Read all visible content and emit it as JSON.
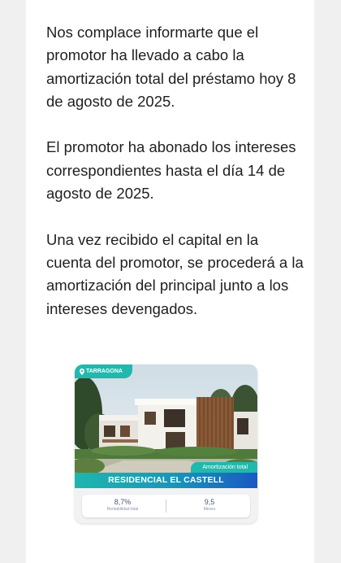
{
  "email": {
    "paragraphs": [
      "Nos complace informarte que el promotor ha llevado a cabo la amortización total del préstamo hoy 8 de agosto de 2025.",
      "El promotor ha abonado los intereses correspondientes hasta el día 14 de agosto de 2025.",
      "Una vez recibido el capital en la cuenta del promotor, se procederá a la amortización del principal junto a los intereses devengados."
    ]
  },
  "project_card": {
    "location": "TARRAGONA",
    "status_tag": "Amortización total",
    "title": "RESIDENCIAL EL CASTELL",
    "stats": [
      {
        "value": "8,7%",
        "label": "Rentabilidad total"
      },
      {
        "value": "9,5",
        "label": "Meses"
      }
    ]
  },
  "colors": {
    "accent_teal": "#20b9ad",
    "accent_blue": "#1a58c4"
  },
  "icons": {
    "location": "map-pin-icon"
  }
}
